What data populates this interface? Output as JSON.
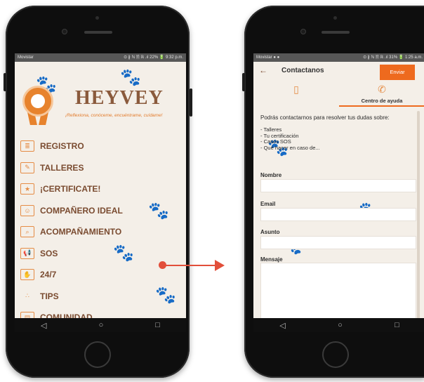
{
  "left_phone": {
    "status": {
      "carrier": "Movistar",
      "right": "⊙ ∦ ℕ 🗎 ℝ .ıl 22% 🔋 9:32 p.m."
    },
    "brand": "HEYVEY",
    "tagline": "¡Reflexiona, conóceme, encuéntrame, cuídame!",
    "menu": [
      {
        "label": "REGISTRO",
        "icon": "id-card-icon",
        "glyph": "≣"
      },
      {
        "label": "TALLERES",
        "icon": "notepad-edit-icon",
        "glyph": "✎"
      },
      {
        "label": "¡CERTIFICATE!",
        "icon": "certificate-icon",
        "glyph": "★"
      },
      {
        "label": "COMPAÑERO IDEAL",
        "icon": "dog-face-icon",
        "glyph": "☺"
      },
      {
        "label": "ACOMPAÑAMIENTO",
        "icon": "search-paw-icon",
        "glyph": "⌕"
      },
      {
        "label": "SOS",
        "icon": "megaphone-icon",
        "glyph": "📢"
      },
      {
        "label": "24/7",
        "icon": "hand-icon",
        "glyph": "✋"
      },
      {
        "label": "TIPS",
        "icon": "tips-icon",
        "glyph": "∴"
      },
      {
        "label": "COMUNIDAD",
        "icon": "community-doc-icon",
        "glyph": "▤"
      }
    ],
    "nav": {
      "back": "◁",
      "home": "○",
      "recent": "□"
    }
  },
  "right_phone": {
    "status": {
      "carrier": "Movistar ● ●",
      "right": "⊙ ∦ ℕ 🗎 ℝ .ıl 31% 🔋 1:25 a.m."
    },
    "title": "Contactanos",
    "send_label": "Enviar",
    "tabs": [
      {
        "label": "",
        "icon": "doc-icon"
      },
      {
        "label": "Centro de ayuda",
        "icon": "phone-icon"
      }
    ],
    "intro": "Podrás contactarnos para resolver tus dudas sobre:",
    "topics": [
      "- Talleres",
      "- Tu certificación",
      "- Casos SOS",
      "- Qué hacer en caso de..."
    ],
    "fields": {
      "name_label": "Nombre",
      "email_label": "Email",
      "subject_label": "Asunto",
      "message_label": "Mensaje"
    },
    "nav": {
      "back": "◁",
      "home": "○",
      "recent": "□"
    }
  },
  "colors": {
    "accent": "#ee6a1e",
    "brand_brown": "#7a4b30",
    "arrow": "#e24f3a"
  }
}
